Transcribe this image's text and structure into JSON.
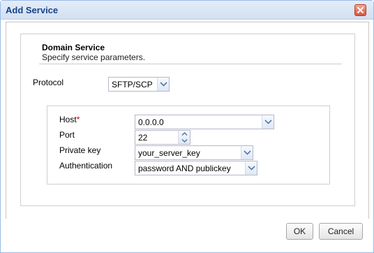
{
  "dialog": {
    "title": "Add Service"
  },
  "section": {
    "title": "Domain Service",
    "subtitle": "Specify service parameters."
  },
  "protocol": {
    "label": "Protocol",
    "value": "SFTP/SCP"
  },
  "fields": {
    "host": {
      "label": "Host",
      "required_mark": "*",
      "value": "0.0.0.0"
    },
    "port": {
      "label": "Port",
      "value": "22"
    },
    "private_key": {
      "label": "Private key",
      "value": "your_server_key"
    },
    "authentication": {
      "label": "Authentication",
      "value": "password AND publickey"
    }
  },
  "buttons": {
    "ok": "OK",
    "cancel": "Cancel"
  },
  "colors": {
    "title_text": "#15428b",
    "titlebar": "#dfe8f6",
    "close_button": "#d9553c",
    "required": "#c00000"
  }
}
